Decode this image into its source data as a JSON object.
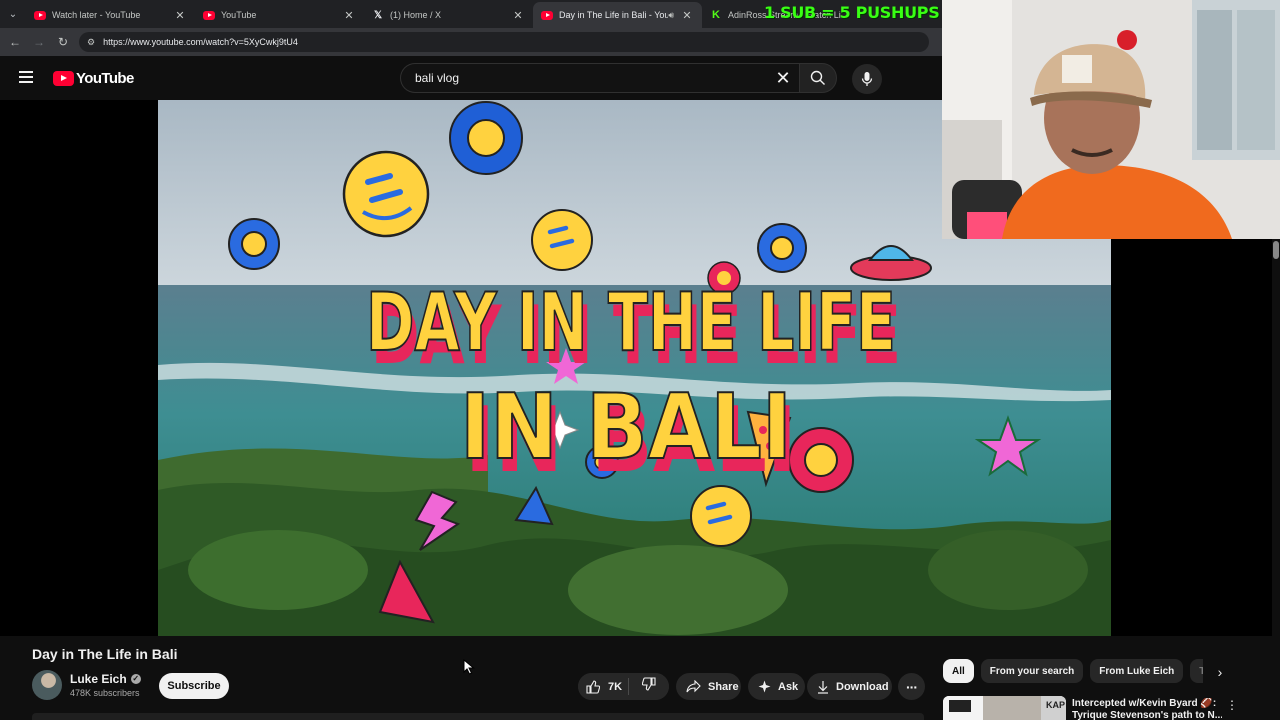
{
  "browser": {
    "tabs": [
      {
        "title": "Watch later - YouTube",
        "favicon": "youtube-icon",
        "active": false
      },
      {
        "title": "YouTube",
        "favicon": "youtube-icon",
        "active": false
      },
      {
        "title": "(1) Home / X",
        "favicon": "x-icon",
        "active": false
      },
      {
        "title": "Day in The Life in Bali - You",
        "favicon": "youtube-icon",
        "active": true,
        "audio": true
      },
      {
        "title": "AdinRoss Stream - Watch Li",
        "favicon": "kick-icon",
        "active": false
      }
    ],
    "url": "https://www.youtube.com/watch?v=5XyCwkj9tU4"
  },
  "masthead": {
    "logo_text": "YouTube",
    "search_value": "bali vlog",
    "icons": [
      "menu-icon",
      "search-icon",
      "mic-icon",
      "clear-icon"
    ]
  },
  "overlay": {
    "sub_banner": "1 SUB = 5 PUSHUPS"
  },
  "video": {
    "title_art_line1": "DAY IN THE LIFE",
    "title_art_line2": "IN BALI"
  },
  "watch": {
    "title": "Day in The Life in Bali",
    "channel_name": "Luke Eich",
    "subscriber_count": "478K subscribers",
    "subscribe_label": "Subscribe",
    "like_count": "7K",
    "share_label": "Share",
    "ask_label": "Ask",
    "download_label": "Download"
  },
  "related": {
    "chips": [
      "All",
      "From your search",
      "From Luke Eich",
      "Tra"
    ],
    "first_item_title_line1": "Intercepted w/Kevin Byard 🏈:",
    "first_item_title_line2": "Tyrique Stevenson's path to N...",
    "first_item_thumb_text": "KAP"
  },
  "colors": {
    "background": "#0f0f0f",
    "youtube_red": "#ff0033",
    "banner_green": "#39ff14",
    "chip_bg": "#272727"
  }
}
